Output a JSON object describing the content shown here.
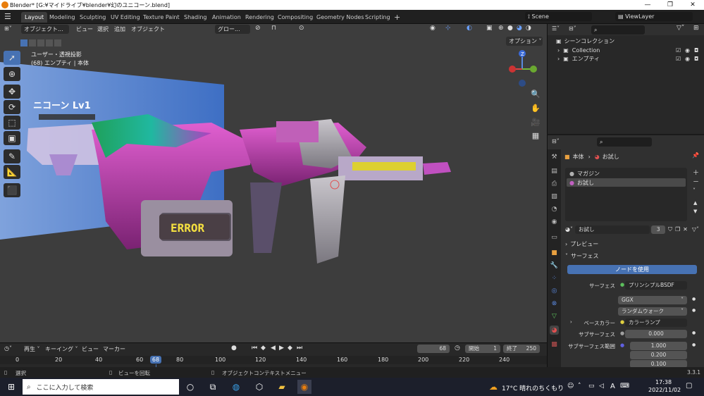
{
  "window": {
    "title": "Blender* [G:¥マイドライブ¥blender¥幻のユニコーン.blend]",
    "minimize": "—",
    "maximize": "❐",
    "close": "✕"
  },
  "menu": {
    "file_icon": "hamburger-icon",
    "workspaces": [
      "Layout",
      "Modeling",
      "Sculpting",
      "UV Editing",
      "Texture Paint",
      "Shading",
      "Animation",
      "Rendering",
      "Compositing",
      "Geometry Nodes",
      "Scripting",
      "+"
    ],
    "active_workspace": "Layout",
    "scene": "Scene",
    "view_layer": "ViewLayer"
  },
  "viewport": {
    "mode": "オブジェクト...",
    "menus": [
      "ビュー",
      "選択",
      "追加",
      "オブジェクト"
    ],
    "transform": "グロー...",
    "options": "オプション ˅",
    "view_name": "ユーザー・透視投影",
    "object_info": "(68) エンプティ | 本体",
    "axis": {
      "z": "Z",
      "x": "",
      "y": ""
    },
    "billboard_text": "ニコーン Lv1",
    "error_sign": "ERROR"
  },
  "outliner": {
    "root": "シーンコレクション",
    "items": [
      {
        "label": "Collection"
      },
      {
        "label": "エンプティ"
      }
    ]
  },
  "properties": {
    "breadcrumb_obj": "本体",
    "breadcrumb_mat": "お試し",
    "slots": [
      "マガジン",
      "お試し"
    ],
    "material_name": "お試し",
    "users": "3",
    "panel_preview": "プレビュー",
    "panel_surface": "サーフェス",
    "use_nodes": "ノードを使用",
    "rows": [
      {
        "label": "サーフェス",
        "value": "プリンシプルBSDF"
      },
      {
        "label": "",
        "value": "GGX"
      },
      {
        "label": "",
        "value": "ランダムウォーク"
      },
      {
        "label": "ベースカラー",
        "value": "カラーランプ"
      },
      {
        "label": "サブサーフェス",
        "value": "0.000"
      },
      {
        "label": "サブサーフェス範囲",
        "value": "1.000"
      },
      {
        "label": "",
        "value": "0.200"
      },
      {
        "label": "",
        "value": "0.100"
      }
    ]
  },
  "timeline": {
    "menus": [
      "再生 ˅",
      "キーイング ˅",
      "ビュー",
      "マーカー"
    ],
    "current_frame": "68",
    "start_label": "開始",
    "start": "1",
    "end_label": "終了",
    "end": "250",
    "ticks": [
      "0",
      "20",
      "40",
      "60",
      "80",
      "100",
      "120",
      "140",
      "160",
      "180",
      "200",
      "220",
      "240"
    ],
    "playhead": "68"
  },
  "status": {
    "select": "選択",
    "rotate": "ビューを回転",
    "context": "オブジェクトコンテキストメニュー",
    "version": "3.3.1"
  },
  "taskbar": {
    "search": "ここに入力して検索",
    "weather": "17°C 晴れのちくもり",
    "ime": "A",
    "time": "17:38",
    "date": "2022/11/02"
  }
}
